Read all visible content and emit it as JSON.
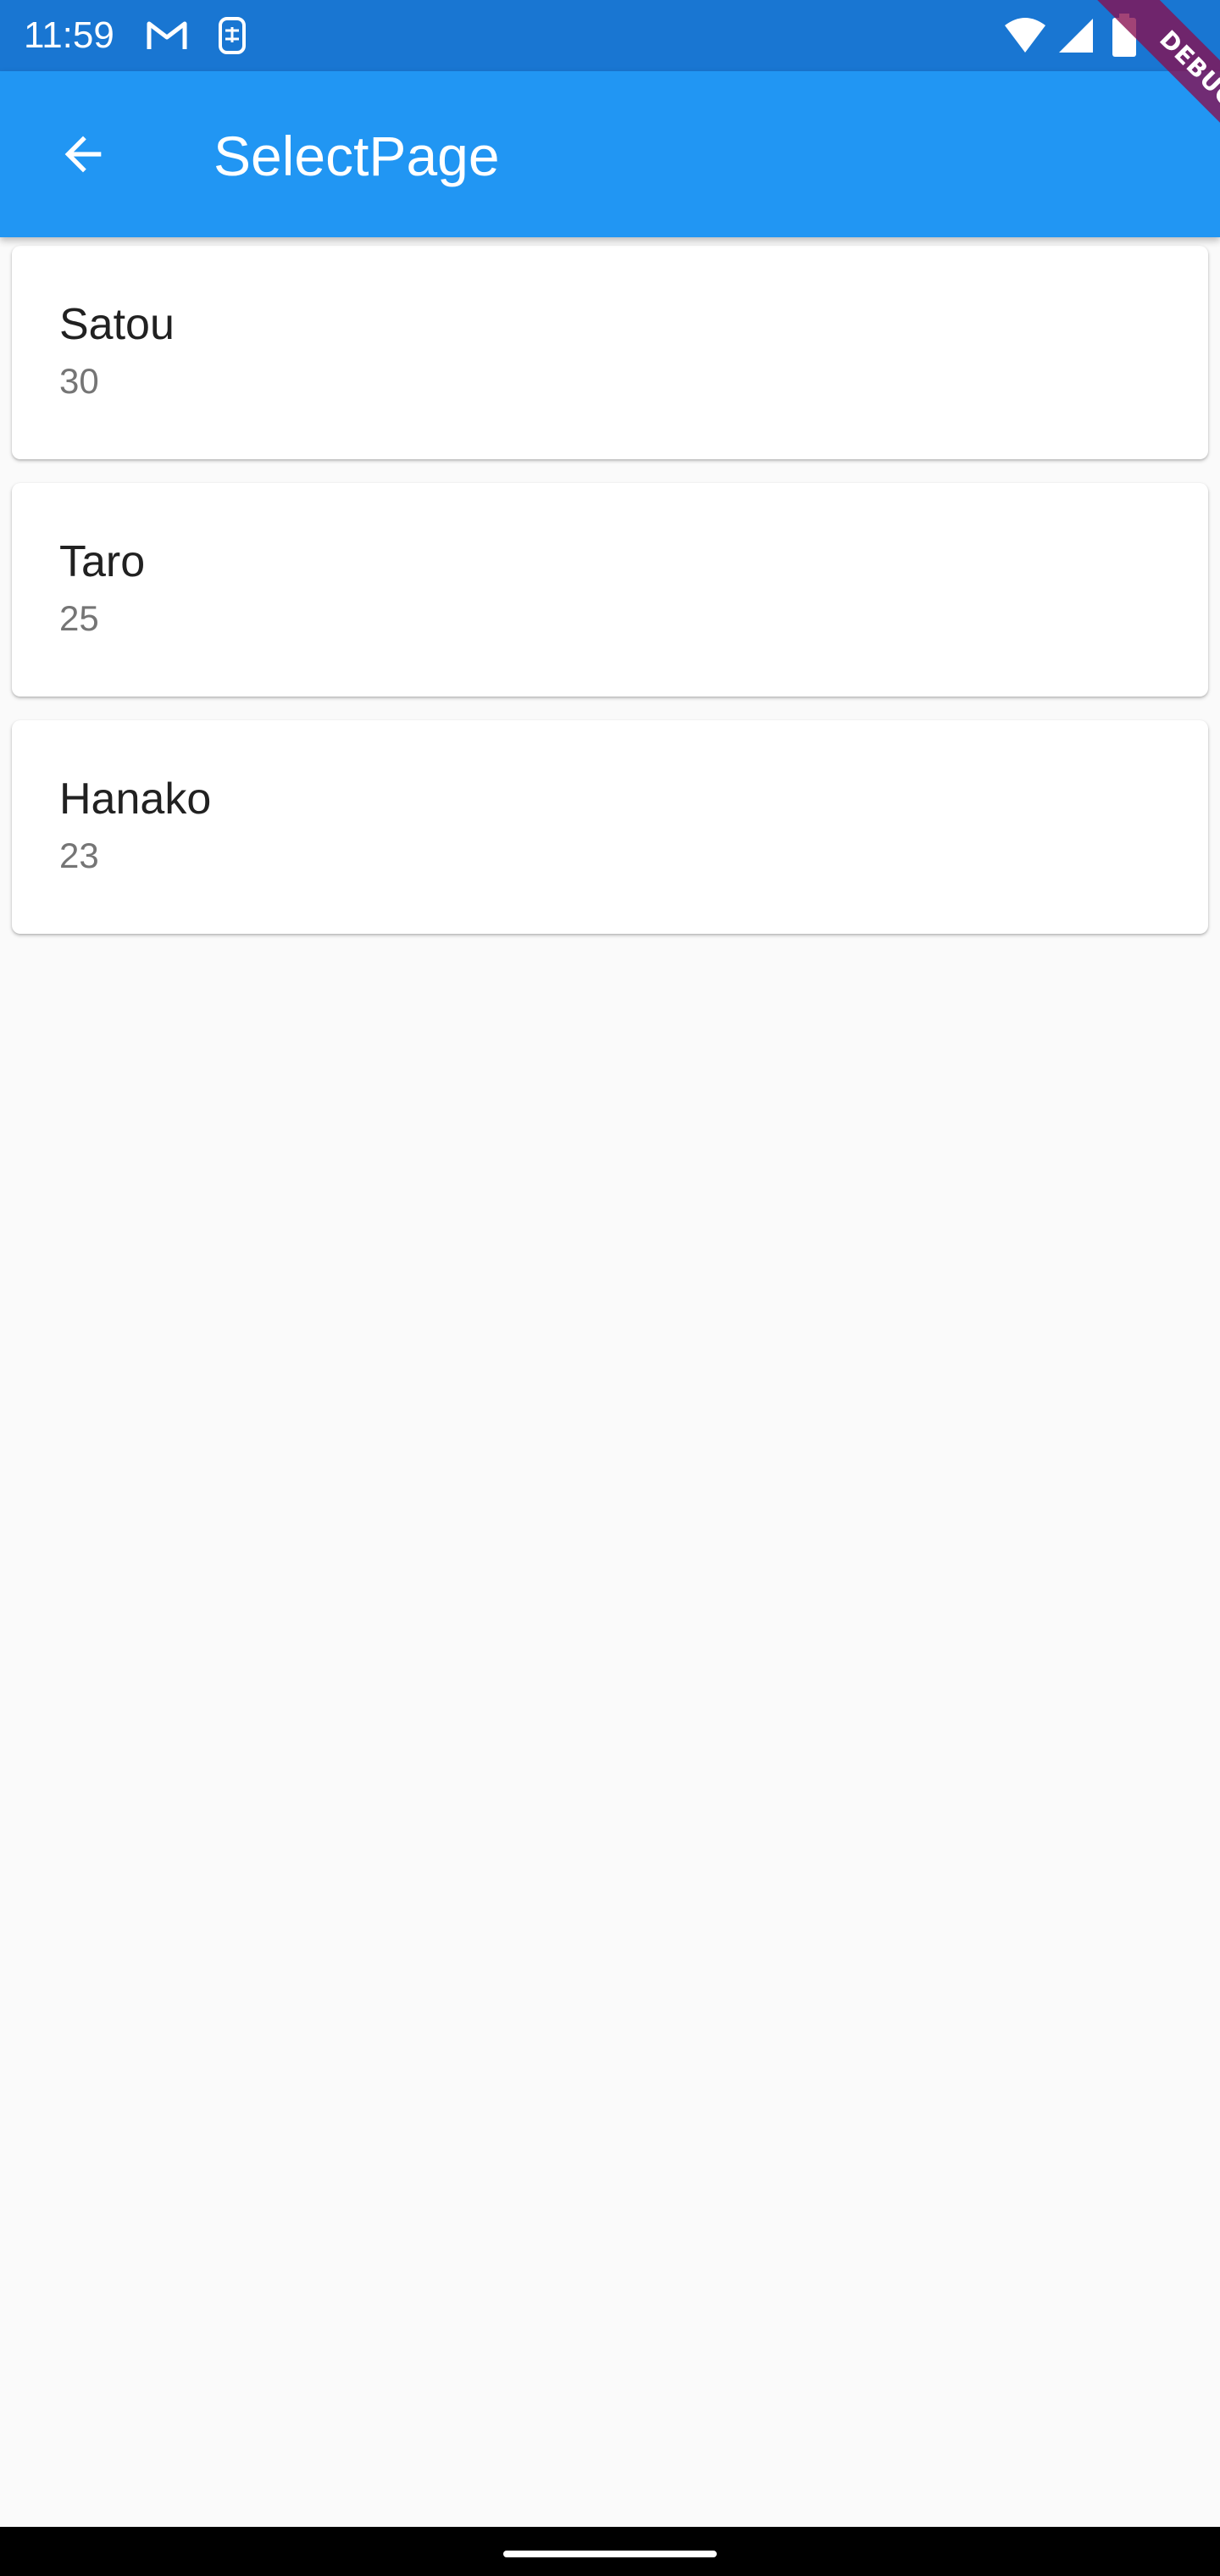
{
  "status_bar": {
    "time": "11:59",
    "icons": [
      "gmail-icon",
      "sim-card-icon",
      "wifi-icon",
      "signal-icon",
      "battery-icon"
    ]
  },
  "app_bar": {
    "title": "SelectPage",
    "back_icon": "arrow-back-icon",
    "color": "#2196f3"
  },
  "debug_banner": {
    "label": "DEBUG"
  },
  "people": [
    {
      "name": "Satou",
      "age": "30"
    },
    {
      "name": "Taro",
      "age": "25"
    },
    {
      "name": "Hanako",
      "age": "23"
    }
  ],
  "colors": {
    "status_bar": "#1976d2",
    "app_bar": "#2196f3",
    "background": "#fafafa",
    "card": "#ffffff",
    "debug_ribbon": "#880e4f"
  }
}
